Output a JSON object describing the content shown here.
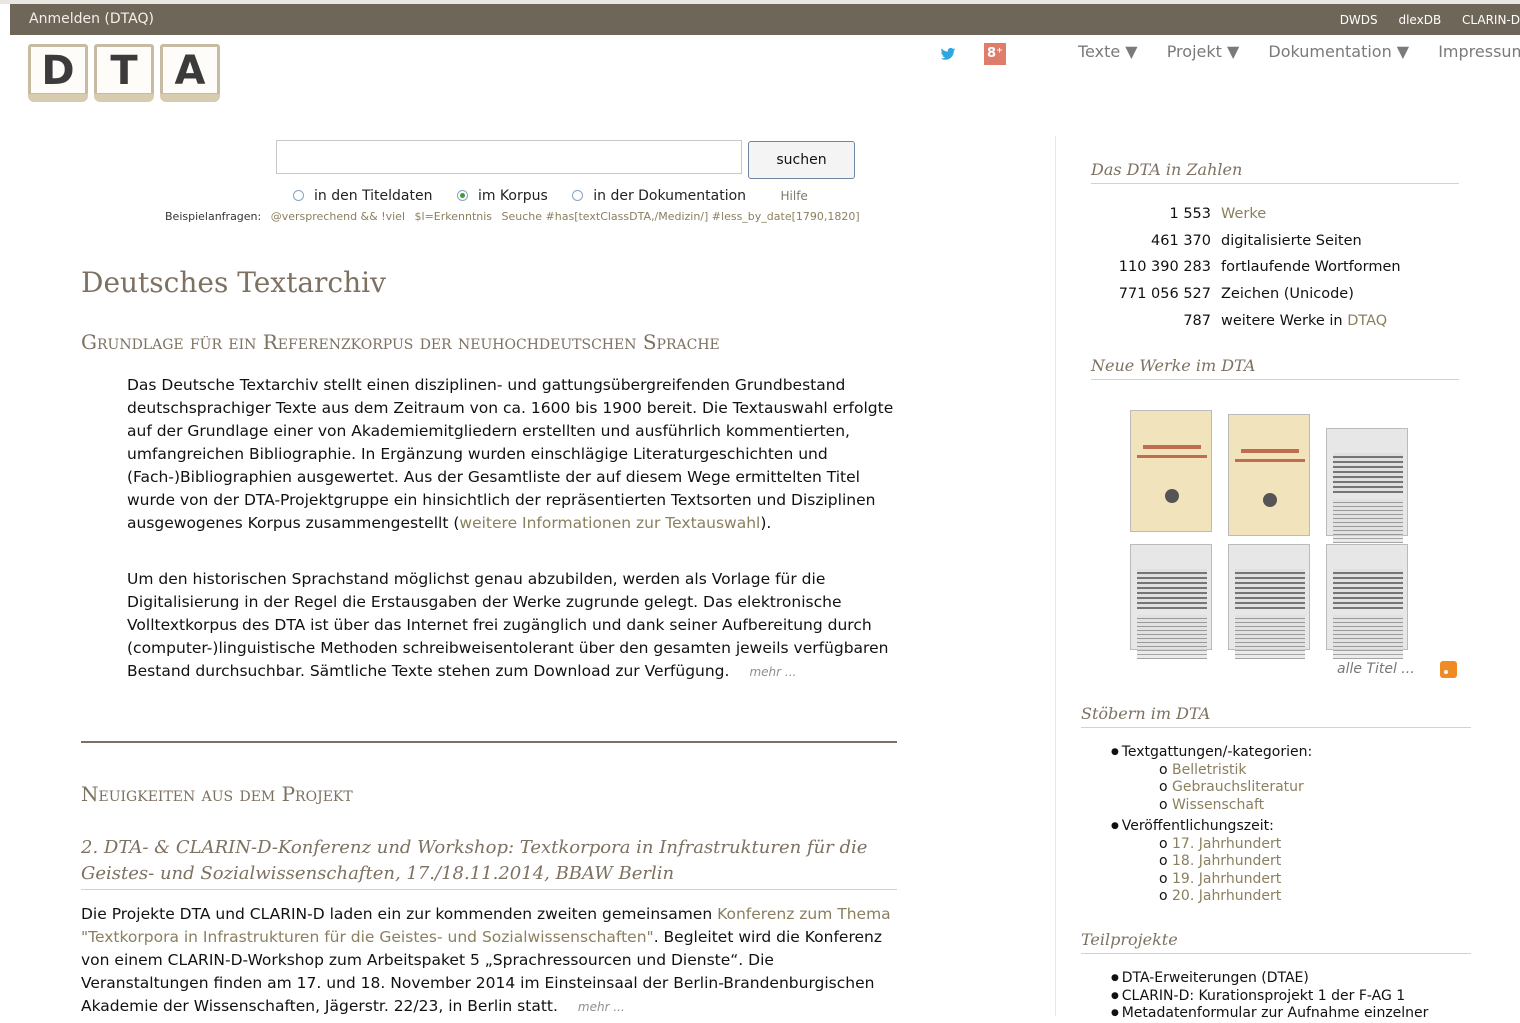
{
  "topbar": {
    "login": "Anmelden (DTAQ)",
    "links": [
      "DWDS",
      "dlexDB",
      "CLARIN-D"
    ]
  },
  "logo": {
    "letters": [
      "D",
      "T",
      "A"
    ]
  },
  "social": {
    "gplus_label": "8⁺"
  },
  "nav": [
    "Texte ▼",
    "Projekt ▼",
    "Dokumentation ▼",
    "Impressum"
  ],
  "search": {
    "value": "",
    "button": "suchen",
    "options": [
      "in den Titeldaten",
      "im Korpus",
      "in der Dokumentation"
    ],
    "selected": "im Korpus",
    "help": "Hilfe",
    "examples_label": "Beispielanfragen:",
    "examples": [
      "@versprechend && !viel",
      "$l=Erkenntnis",
      "Seuche #has[textClassDTA,/Medizin/] #less_by_date[1790,1820]"
    ]
  },
  "main": {
    "title": "Deutsches Textarchiv",
    "subtitle": "Grundlage für ein Referenzkorpus der neuhochdeutschen Sprache",
    "para1_pre": "Das Deutsche Textarchiv stellt einen disziplinen- und gattungsübergreifenden Grundbestand deutschsprachiger Texte aus dem Zeitraum von ca. 1600 bis 1900 bereit. Die Textauswahl erfolgte auf der Grundlage einer von Akademiemitgliedern erstellten und ausführlich kommentierten, umfangreichen Bibliographie. In Ergänzung wurden einschlägige Literaturgeschichten und (Fach-)Bibliographien ausgewertet. Aus der Gesamtliste der auf diesem Wege ermittelten Titel wurde von der DTA-Projektgruppe ein hinsichtlich der repräsentierten Textsorten und Disziplinen ausgewogenes Korpus zusammengestellt (",
    "para1_link": "weitere Informationen zur Textauswahl",
    "para1_post": ").",
    "para2": "Um den historischen Sprachstand möglichst genau abzubilden, werden als Vorlage für die Digitalisierung in der Regel die Erstausgaben der Werke zugrunde gelegt. Das elektronische Volltextkorpus des DTA ist über das Internet frei zugänglich und dank seiner Aufbereitung durch (computer-)linguistische Methoden schreibweisentolerant über den gesamten jeweils verfügbaren Bestand durchsuchbar. Sämtliche Texte stehen zum Download zur Verfügung.",
    "more": "mehr ...",
    "news_heading": "Neuigkeiten aus dem Projekt",
    "news_title": "2. DTA- & CLARIN-D-Konferenz und Workshop: Textkorpora in Infrastrukturen für die Geistes- und Sozialwissenschaften, 17./18.11.2014, BBAW Berlin",
    "news_pre": "Die Projekte DTA und CLARIN-D laden ein zur kommenden zweiten gemeinsamen ",
    "news_link": "Konferenz zum Thema \"Textkorpora in Infrastrukturen für die Geistes- und Sozialwissenschaften\"",
    "news_post": ". Begleitet wird die Konferenz von einem CLARIN-D-Workshop zum Arbeitspaket 5 „Sprachressourcen und Dienste“. Die Veranstaltungen finden am 17. und 18. November 2014 im Einsteinsaal der Berlin-Brandenburgischen Akademie der Wissenschaften, Jägerstr. 22/23, in Berlin statt."
  },
  "sidebar": {
    "stats_heading": "Das DTA in Zahlen",
    "stats": [
      {
        "num": "1 553",
        "label": "Werke"
      },
      {
        "num": "461 370",
        "label": "digitalisierte Seiten"
      },
      {
        "num": "110 390 283",
        "label": "fortlaufende Wortformen"
      },
      {
        "num": "771 056 527",
        "label": "Zeichen (Unicode)"
      },
      {
        "num": "787",
        "label": "weitere Werke in ",
        "link": "DTAQ"
      }
    ],
    "new_heading": "Neue Werke im DTA",
    "all_titles": "alle Titel ...",
    "browse_heading": "Stöbern im DTA",
    "browse": {
      "genre_label": "Textgattungen/-kategorien:",
      "genres": [
        "Belletristik",
        "Gebrauchsliteratur",
        "Wissenschaft"
      ],
      "period_label": "Veröffentlichungszeit:",
      "periods": [
        "17. Jahrhundert",
        "18. Jahrhundert",
        "19. Jahrhundert",
        "20. Jahrhundert"
      ]
    },
    "sub_heading": "Teilprojekte",
    "subprojects": [
      "DTA-Erweiterungen (DTAE)",
      "CLARIN-D: Kurationsprojekt 1 der F-AG 1",
      "Metadatenformular zur Aufnahme einzelner"
    ]
  }
}
